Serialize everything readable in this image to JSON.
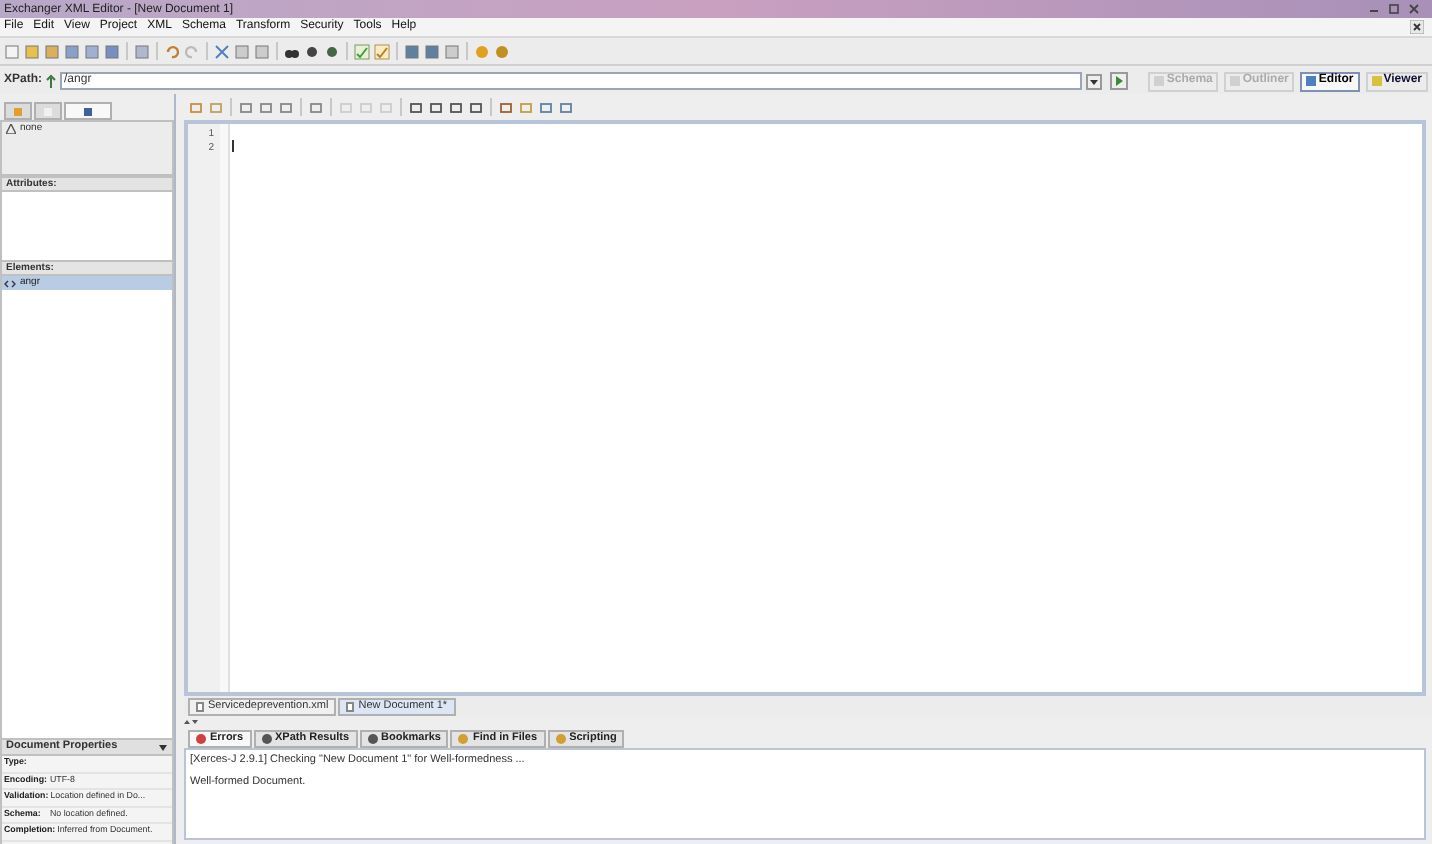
{
  "window": {
    "title": "Exchanger XML Editor - [New Document 1]"
  },
  "menu": [
    "File",
    "Edit",
    "View",
    "Project",
    "XML",
    "Schema",
    "Transform",
    "Security",
    "Tools",
    "Help"
  ],
  "xpath": {
    "label": "XPath:",
    "value": "/angr"
  },
  "view_buttons": [
    {
      "label": "Schema",
      "selected": false,
      "disabled": true
    },
    {
      "label": "Outliner",
      "selected": false,
      "disabled": true
    },
    {
      "label": "Editor",
      "selected": true,
      "disabled": false
    },
    {
      "label": "Viewer",
      "selected": false,
      "disabled": false
    }
  ],
  "left_tabs": [
    {
      "selected": false
    },
    {
      "selected": false
    },
    {
      "selected": true
    }
  ],
  "navigator": {
    "item": "none"
  },
  "attributes": {
    "title": "Attributes:"
  },
  "elements": {
    "title": "Elements:",
    "items": [
      {
        "label": "angr",
        "selected": true
      }
    ]
  },
  "document_properties": {
    "title": "Document Properties",
    "rows": [
      {
        "label": "Type:",
        "value": ""
      },
      {
        "label": "Encoding:",
        "value": "UTF-8"
      },
      {
        "label": "Validation:",
        "value": "Location defined in Do..."
      },
      {
        "label": "Schema:",
        "value": "No location defined."
      },
      {
        "label": "Completion:",
        "value": "Inferred from Document."
      }
    ]
  },
  "editor": {
    "line_numbers": [
      "1",
      "2"
    ]
  },
  "document_tabs": [
    {
      "label": "Servicedeprevention.xml",
      "selected": false
    },
    {
      "label": "New Document 1*",
      "selected": true
    }
  ],
  "output_tabs": [
    {
      "label": "Errors",
      "selected": true
    },
    {
      "label": "XPath Results",
      "selected": false
    },
    {
      "label": "Bookmarks",
      "selected": false
    },
    {
      "label": "Find in Files",
      "selected": false
    },
    {
      "label": "Scripting",
      "selected": false
    }
  ],
  "output_lines": [
    "[Xerces-J 2.9.1] Checking \"New Document 1\" for Well-formedness ...",
    "Well-formed Document."
  ]
}
